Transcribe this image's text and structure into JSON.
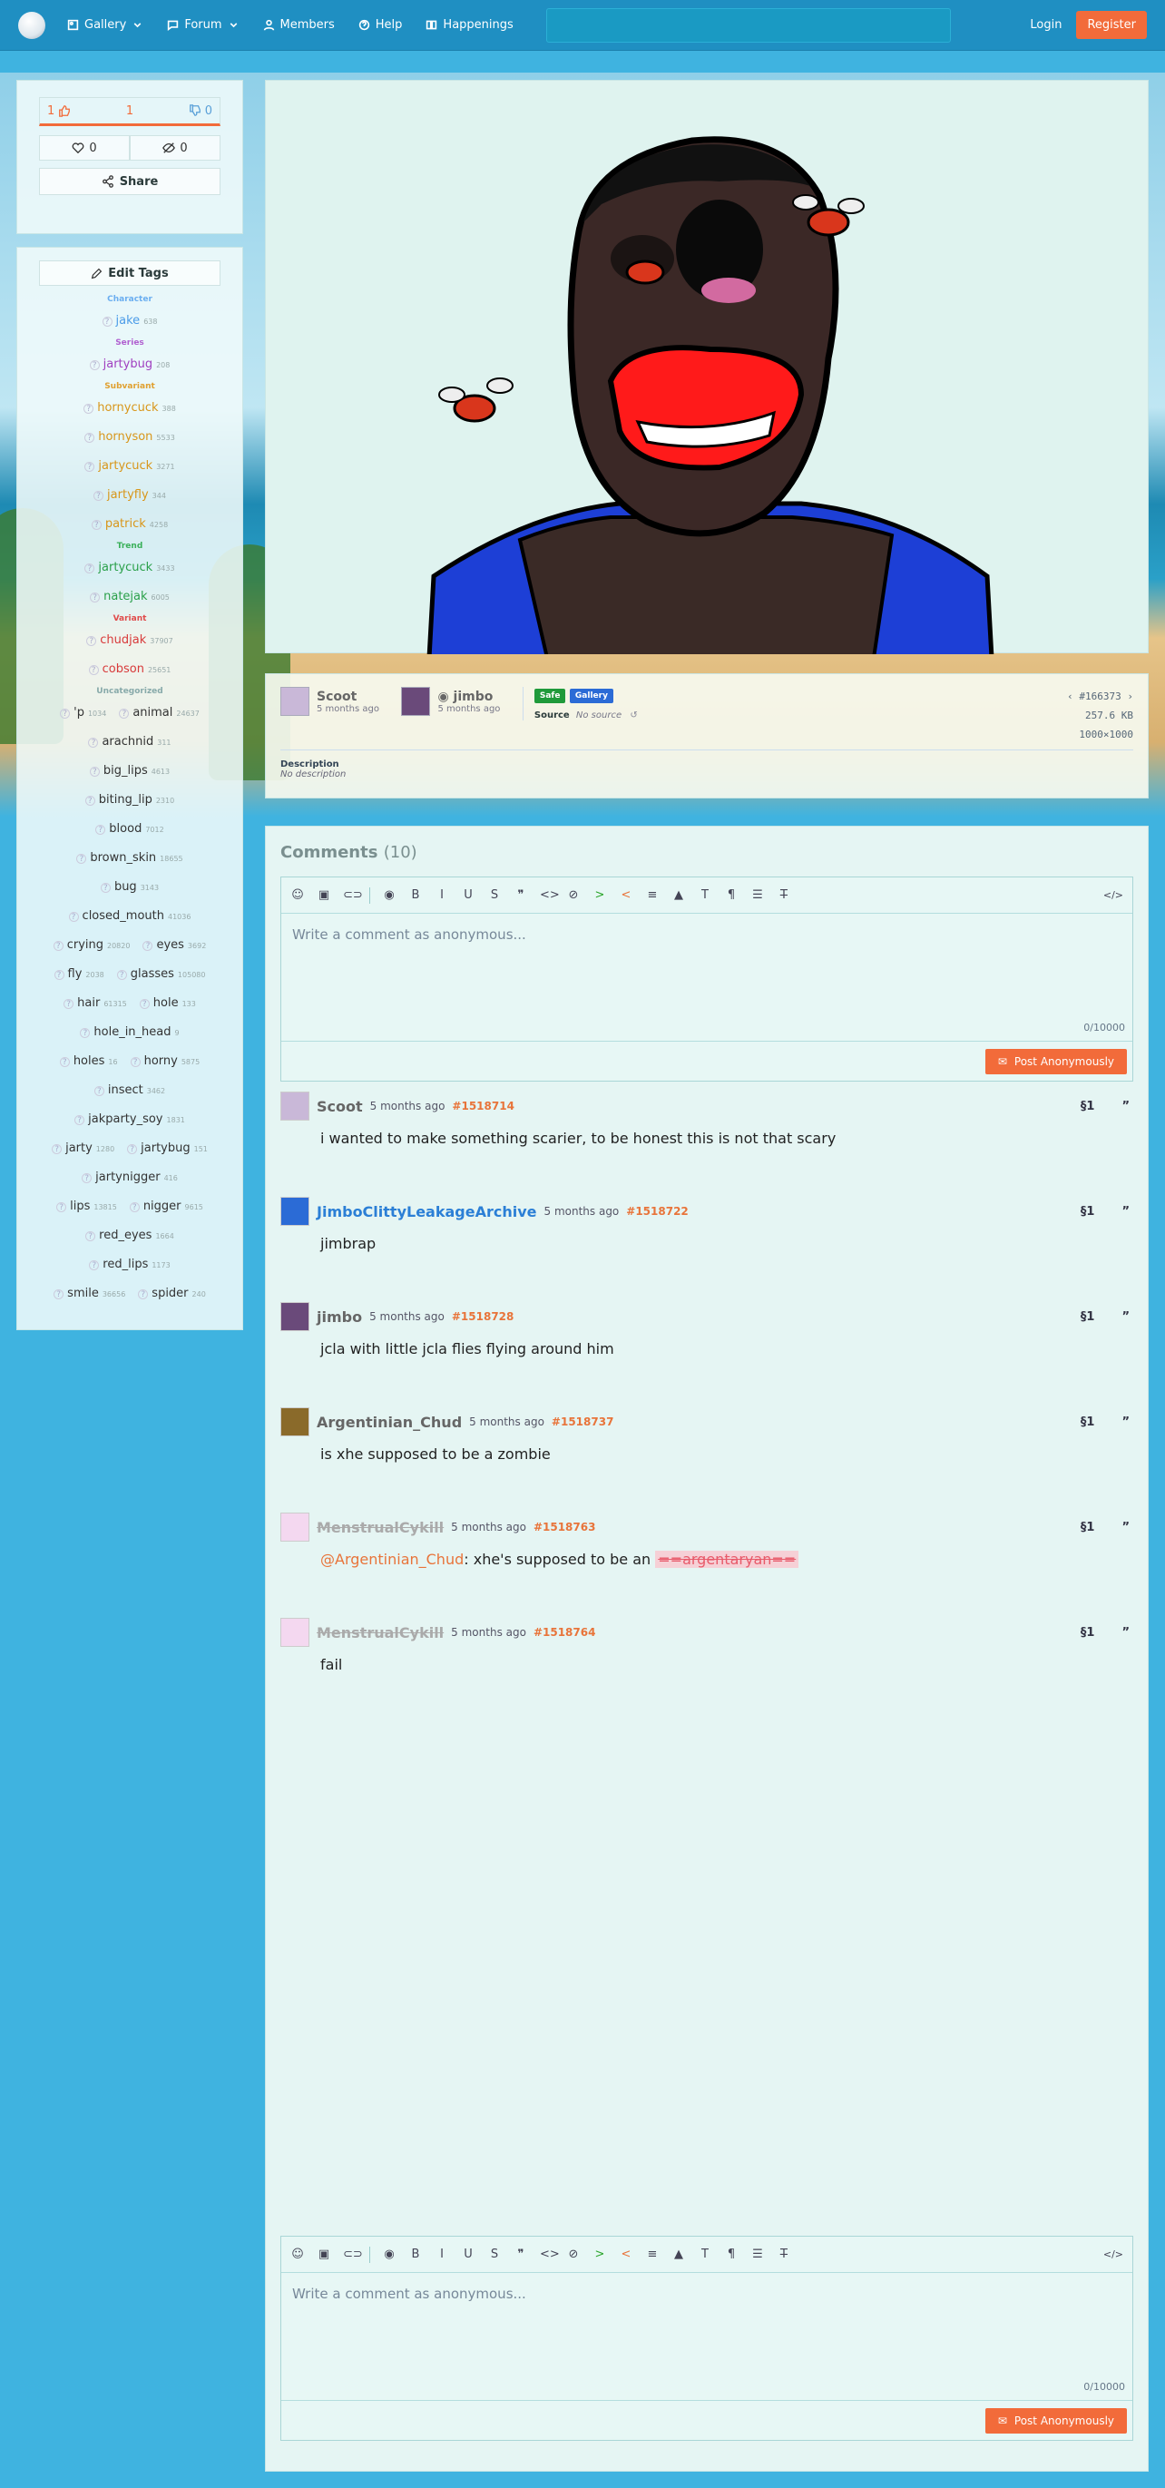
{
  "nav": {
    "gallery": "Gallery",
    "forum": "Forum",
    "members": "Members",
    "help": "Help",
    "happenings": "Happenings",
    "search_placeholder": "",
    "login": "Login",
    "register": "Register"
  },
  "votes": {
    "up": "1",
    "score": "1",
    "down": "0",
    "favorites": "0",
    "hides": "0",
    "share": "Share"
  },
  "tags": {
    "edit": "Edit Tags",
    "categories": {
      "character": "Character",
      "series": "Series",
      "subvariant": "Subvariant",
      "trend": "Trend",
      "variant": "Variant",
      "uncategorized": "Uncategorized"
    },
    "character": [
      {
        "name": "jake",
        "count": "638"
      }
    ],
    "series": [
      {
        "name": "jartybug",
        "count": "208"
      }
    ],
    "subvariant": [
      {
        "name": "hornycuck",
        "count": "388"
      },
      {
        "name": "hornyson",
        "count": "5533"
      },
      {
        "name": "jartycuck",
        "count": "3271"
      },
      {
        "name": "jartyfly",
        "count": "344"
      },
      {
        "name": "patrick",
        "count": "4258"
      }
    ],
    "trend": [
      {
        "name": "jartycuck",
        "count": "3433"
      },
      {
        "name": "natejak",
        "count": "6005"
      }
    ],
    "variant": [
      {
        "name": "chudjak",
        "count": "37907"
      },
      {
        "name": "cobson",
        "count": "25651"
      }
    ],
    "uncategorized": [
      {
        "name": "'p",
        "count": "1034"
      },
      {
        "name": "animal",
        "count": "24637"
      },
      {
        "name": "arachnid",
        "count": "311"
      },
      {
        "name": "big_lips",
        "count": "4613"
      },
      {
        "name": "biting_lip",
        "count": "2310"
      },
      {
        "name": "blood",
        "count": "7012"
      },
      {
        "name": "brown_skin",
        "count": "18655"
      },
      {
        "name": "bug",
        "count": "3143"
      },
      {
        "name": "closed_mouth",
        "count": "41036"
      },
      {
        "name": "crying",
        "count": "20820"
      },
      {
        "name": "eyes",
        "count": "3692"
      },
      {
        "name": "fly",
        "count": "2038"
      },
      {
        "name": "glasses",
        "count": "105080"
      },
      {
        "name": "hair",
        "count": "61315"
      },
      {
        "name": "hole",
        "count": "133"
      },
      {
        "name": "hole_in_head",
        "count": "9"
      },
      {
        "name": "holes",
        "count": "16"
      },
      {
        "name": "horny",
        "count": "5875"
      },
      {
        "name": "insect",
        "count": "3462"
      },
      {
        "name": "jakparty_soy",
        "count": "1831"
      },
      {
        "name": "jarty",
        "count": "1280"
      },
      {
        "name": "jartybug",
        "count": "151"
      },
      {
        "name": "jartynigger",
        "count": "416"
      },
      {
        "name": "lips",
        "count": "13815"
      },
      {
        "name": "nigger",
        "count": "9615"
      },
      {
        "name": "red_eyes",
        "count": "1664"
      },
      {
        "name": "red_lips",
        "count": "1173"
      },
      {
        "name": "smile",
        "count": "36656"
      },
      {
        "name": "spider",
        "count": "240"
      }
    ]
  },
  "info": {
    "uploader": "Scoot",
    "uploader_date": "5 months ago",
    "artist": "jimbo",
    "artist_date": "5 months ago",
    "rating": "Safe",
    "type": "Gallery",
    "source_label": "Source",
    "source_value": "No source",
    "post_id": "#166373",
    "size": "257.6 KB",
    "dimensions": "1000×1000",
    "description_label": "Description",
    "description": "No description"
  },
  "comments_section": {
    "title": "Comments",
    "count": "(10)",
    "placeholder": "Write a comment as anonymous...",
    "counter": "0/10000",
    "post_button": "Post Anonymously"
  },
  "comments": [
    {
      "name": "Scoot",
      "date": "5 months ago",
      "id": "#1518714",
      "body": "i wanted to make something scarier, to be honest this is not that scary"
    },
    {
      "name": "JimboClittyLeakageArchive",
      "date": "5 months ago",
      "id": "#1518722",
      "body": "jimbrap"
    },
    {
      "name": "jimbo",
      "date": "5 months ago",
      "id": "#1518728",
      "body": "jcla with little jcla flies flying around him"
    },
    {
      "name": "Argentinian_Chud",
      "date": "5 months ago",
      "id": "#1518737",
      "body": "is xhe supposed to be a zombie"
    },
    {
      "name": "MenstrualCykill",
      "date": "5 months ago",
      "id": "#1518763",
      "mention": "@Argentinian_Chud",
      "body": ": xhe's supposed to be an ",
      "spoiler": "==argentaryan=="
    },
    {
      "name": "MenstrualCykill",
      "date": "5 months ago",
      "id": "#1518764",
      "body": "fail"
    }
  ],
  "comment_actions": {
    "quote": "”",
    "ref": "§"
  },
  "colors": {
    "accent": "#f26b3a",
    "nav": "#1f8fc2",
    "background": "#3fb3e0"
  }
}
